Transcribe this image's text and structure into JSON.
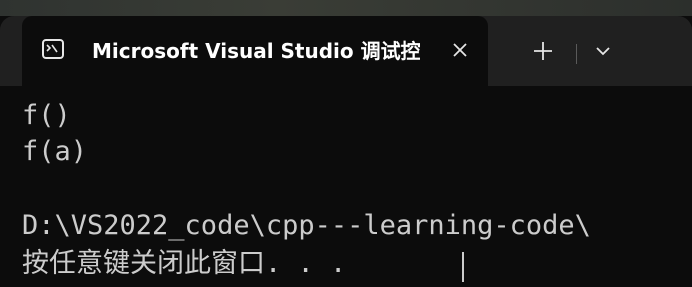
{
  "window": {
    "tab_title": "Microsoft Visual Studio 调试控",
    "tab_icon": "terminal-icon",
    "close_icon": "close-icon",
    "new_tab_icon": "plus-icon",
    "dropdown_icon": "chevron-down-icon"
  },
  "console": {
    "lines": [
      "f()",
      "f(a)",
      "",
      "D:\\VS2022_code\\cpp---learning-code\\",
      "按任意键关闭此窗口. . ."
    ]
  },
  "colors": {
    "background": "#0c0c0c",
    "titlebar": "#202020",
    "text": "#cccccc"
  }
}
